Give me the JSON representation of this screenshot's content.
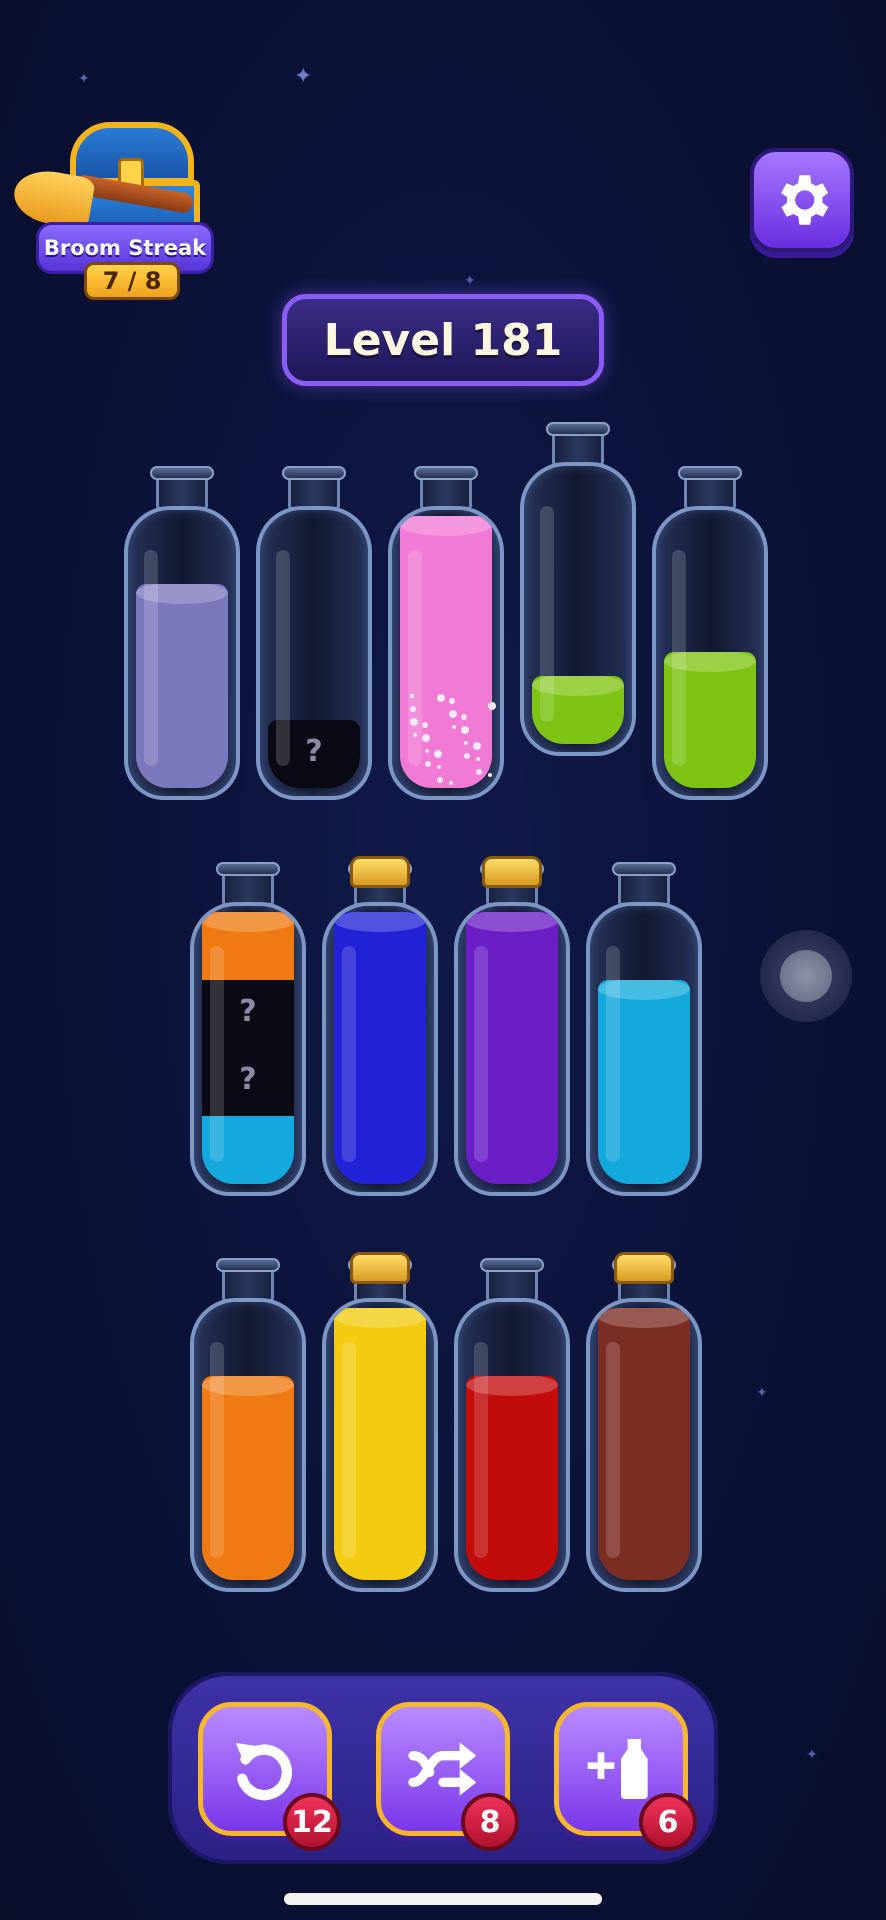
{
  "broom_streak": {
    "label": "Broom Streak",
    "count": "7 / 8"
  },
  "level": {
    "label": "Level 181"
  },
  "colors": {
    "lavender": "#7b78bd",
    "pink": "#f07ad6",
    "lime": "#7fc314",
    "orange": "#ef7a12",
    "cyan": "#13a9dc",
    "blue": "#2222d8",
    "purple": "#6c1ec6",
    "yellow": "#f3cc12",
    "red": "#c20b0b",
    "brown": "#7c2e24",
    "hidden": "#0a0a14"
  },
  "bottles": [
    {
      "row": 1,
      "capped": false,
      "segments": [
        {
          "color": "lavender",
          "units": 3
        }
      ]
    },
    {
      "row": 1,
      "capped": false,
      "segments": [
        {
          "color": "hidden",
          "units": 1,
          "mystery": true
        }
      ]
    },
    {
      "row": 1,
      "capped": false,
      "selected": true,
      "segments": [
        {
          "color": "pink",
          "units": 4
        }
      ]
    },
    {
      "row": 1,
      "capped": false,
      "raised": true,
      "segments": [
        {
          "color": "lime",
          "units": 1
        }
      ]
    },
    {
      "row": 1,
      "capped": false,
      "segments": [
        {
          "color": "lime",
          "units": 2
        }
      ]
    },
    {
      "row": 2,
      "capped": false,
      "segments": [
        {
          "color": "cyan",
          "units": 1
        },
        {
          "color": "hidden",
          "units": 1,
          "mystery": true
        },
        {
          "color": "hidden",
          "units": 1,
          "mystery": true
        },
        {
          "color": "orange",
          "units": 1
        }
      ]
    },
    {
      "row": 2,
      "capped": true,
      "segments": [
        {
          "color": "blue",
          "units": 4
        }
      ]
    },
    {
      "row": 2,
      "capped": true,
      "segments": [
        {
          "color": "purple",
          "units": 4
        }
      ]
    },
    {
      "row": 2,
      "capped": false,
      "segments": [
        {
          "color": "cyan",
          "units": 3
        }
      ]
    },
    {
      "row": 3,
      "capped": false,
      "segments": [
        {
          "color": "orange",
          "units": 3
        }
      ]
    },
    {
      "row": 3,
      "capped": true,
      "segments": [
        {
          "color": "yellow",
          "units": 4
        }
      ]
    },
    {
      "row": 3,
      "capped": false,
      "segments": [
        {
          "color": "red",
          "units": 3
        }
      ]
    },
    {
      "row": 3,
      "capped": true,
      "segments": [
        {
          "color": "brown",
          "units": 4
        }
      ]
    }
  ],
  "mystery_symbol": "?",
  "powerups": {
    "undo": {
      "icon": "undo-icon",
      "count": "12"
    },
    "shuffle": {
      "icon": "shuffle-icon",
      "count": "8"
    },
    "add_bottle": {
      "icon": "add-bottle-icon",
      "count": "6"
    }
  }
}
